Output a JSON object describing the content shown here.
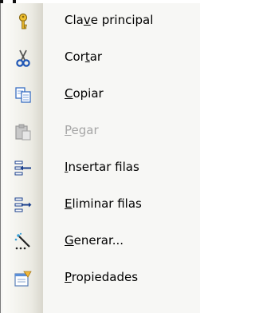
{
  "menu": {
    "items": [
      {
        "pre": "Cla",
        "key": "v",
        "post": "e principal",
        "icon": "key-icon",
        "enabled": true
      },
      {
        "pre": "Cor",
        "key": "t",
        "post": "ar",
        "icon": "scissors-icon",
        "enabled": true
      },
      {
        "pre": "",
        "key": "C",
        "post": "opiar",
        "icon": "copy-icon",
        "enabled": true
      },
      {
        "pre": "",
        "key": "P",
        "post": "egar",
        "icon": "paste-icon",
        "enabled": false
      },
      {
        "pre": "",
        "key": "I",
        "post": "nsertar filas",
        "icon": "insert-rows-icon",
        "enabled": true
      },
      {
        "pre": "",
        "key": "E",
        "post": "liminar filas",
        "icon": "delete-rows-icon",
        "enabled": true
      },
      {
        "pre": "",
        "key": "G",
        "post": "enerar...",
        "icon": "build-icon",
        "enabled": true
      },
      {
        "pre": "",
        "key": "P",
        "post": "ropiedades",
        "icon": "properties-icon",
        "enabled": true
      }
    ]
  }
}
